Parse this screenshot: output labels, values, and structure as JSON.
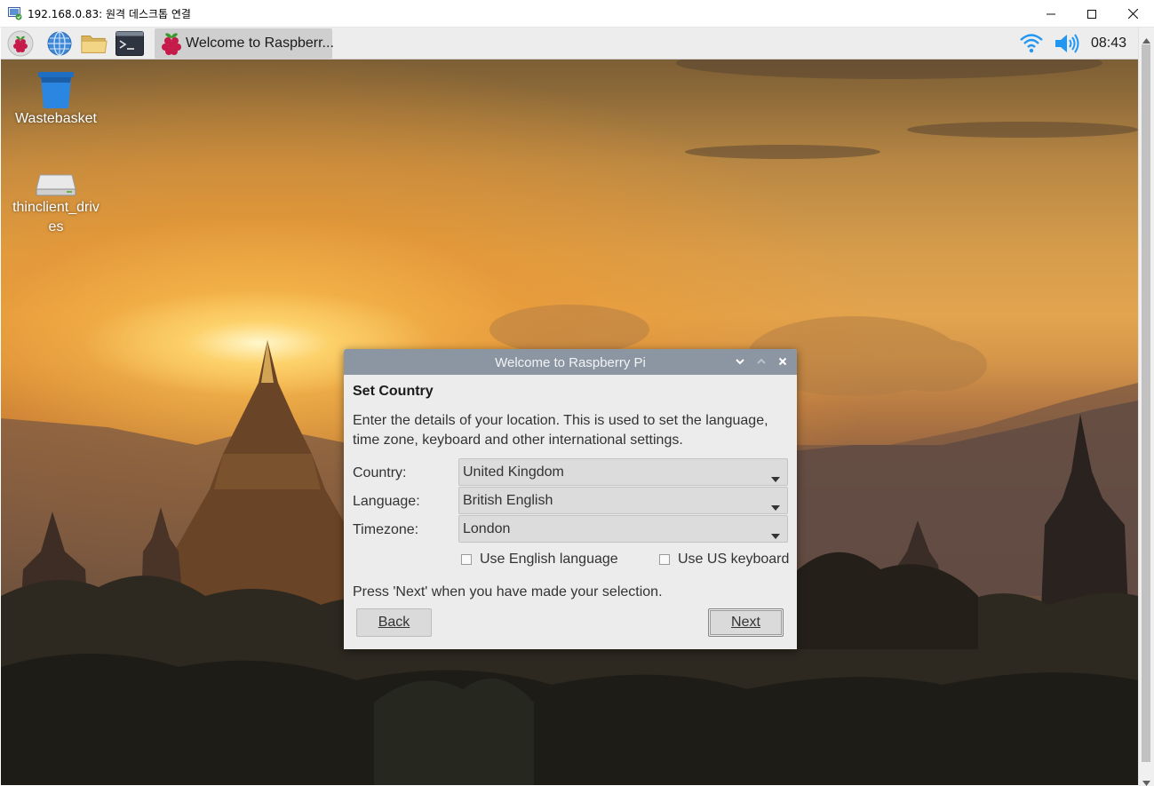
{
  "rdp_window": {
    "title": "192.168.0.83: 원격 데스크톱 연결",
    "controls": [
      "minimize",
      "maximize",
      "close"
    ]
  },
  "panel": {
    "launchers": [
      {
        "name": "raspberry-menu-icon"
      },
      {
        "name": "web-browser-icon"
      },
      {
        "name": "file-manager-icon"
      },
      {
        "name": "terminal-icon"
      }
    ],
    "task_button_label": "Welcome to Raspberr...",
    "tray": {
      "wifi": "wifi-icon",
      "volume": "volume-icon"
    },
    "clock": "08:43"
  },
  "desktop_icons": {
    "wastebasket": "Wastebasket",
    "drives": "thinclient_drives"
  },
  "dialog": {
    "title": "Welcome to Raspberry Pi",
    "heading": "Set Country",
    "description": "Enter the details of your location. This is used to set the language, time zone, keyboard and other international settings.",
    "fields": {
      "country_label": "Country:",
      "country_value": "United Kingdom",
      "language_label": "Language:",
      "language_value": "British English",
      "timezone_label": "Timezone:",
      "timezone_value": "London"
    },
    "checkboxes": {
      "english_language": {
        "label": "Use English language",
        "checked": false
      },
      "us_keyboard": {
        "label": "Use US keyboard",
        "checked": false
      }
    },
    "hint": "Press 'Next' when you have made your selection.",
    "back_label": "Back",
    "next_label": "Next"
  },
  "colors": {
    "dialog_titlebar": "#8c96a2",
    "dialog_bg": "#ececec",
    "panel_bg": "#ededed",
    "accent_blue": "#1e88e5"
  }
}
